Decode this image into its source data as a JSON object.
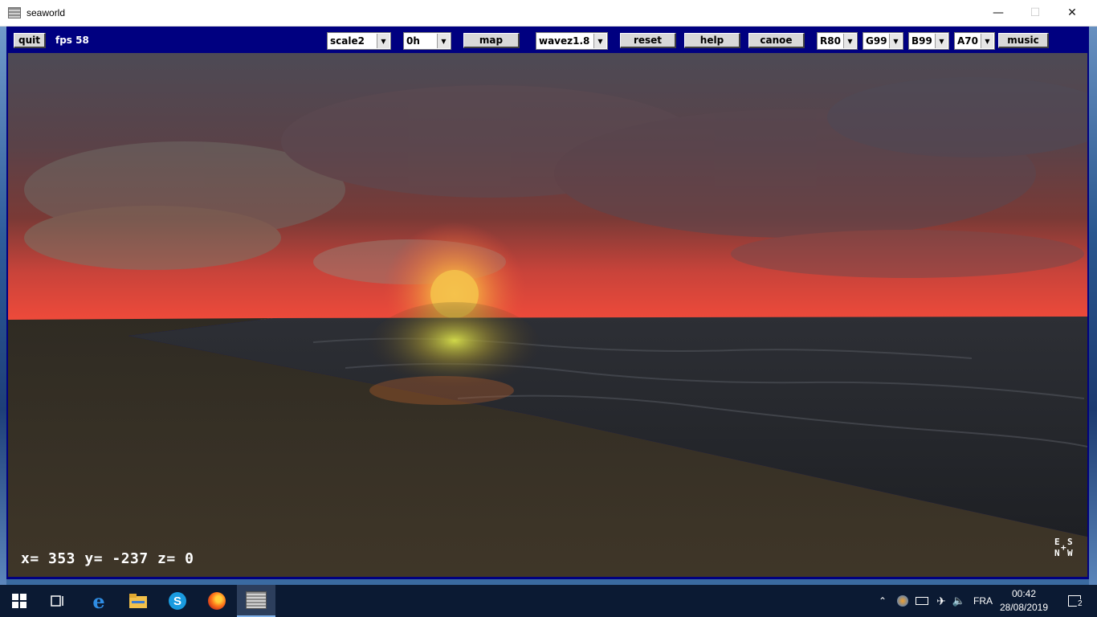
{
  "window": {
    "title": "seaworld",
    "controls": [
      "minimize",
      "maximize",
      "close"
    ]
  },
  "toolbar": {
    "quit_label": "quit",
    "fps_text": "fps 58",
    "scale_select": "scale2",
    "hour_select": "0h",
    "map_label": "map",
    "wave_select": "wavez1.8",
    "reset_label": "reset",
    "help_label": "help",
    "canoe_label": "canoe",
    "red_select": "R80",
    "green_select": "G99",
    "blue_select": "B99",
    "alpha_select": "A70",
    "music_label": "music"
  },
  "scene": {
    "coords_text": "x= 353  y= -237  z= 0",
    "compass": {
      "e": "E",
      "s": "S",
      "n": "N",
      "w": "W",
      "center": "+"
    },
    "colors": {
      "sky_top": "#4a4852",
      "horizon_glow": "#e8443a",
      "sun": "#f6c24a",
      "sea": "#26282c",
      "sand": "#3e3628"
    }
  },
  "taskbar": {
    "icons": [
      "windows-start-icon",
      "task-view-icon",
      "edge-icon",
      "file-explorer-icon",
      "skype-icon",
      "firefox-icon",
      "seaworld-app-icon"
    ],
    "tray_language": "FRA",
    "clock_time": "00:42",
    "clock_date": "28/08/2019",
    "notification_count": "2"
  }
}
